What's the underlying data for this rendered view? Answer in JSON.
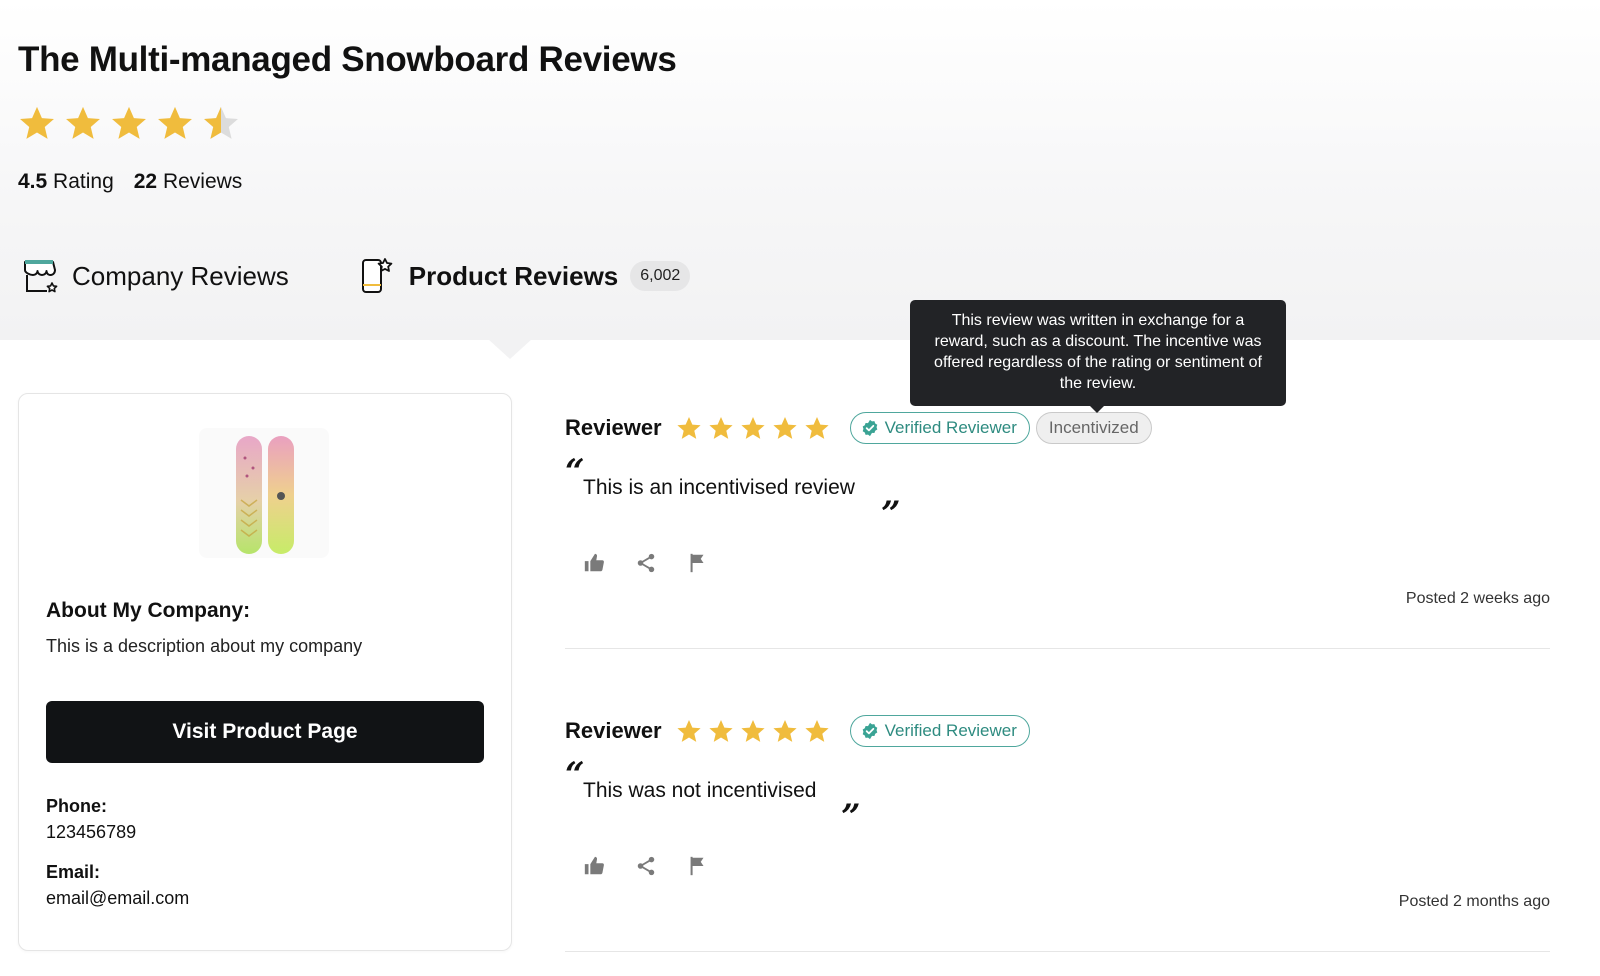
{
  "page": {
    "title": "The Multi-managed Snowboard Reviews",
    "rating_value": "4.5",
    "rating_label": "Rating",
    "reviews_value": "22",
    "reviews_label": "Reviews",
    "rating_stars": 4.5
  },
  "tabs": [
    {
      "label": "Company Reviews",
      "icon": "store-star-icon",
      "active": false
    },
    {
      "label": "Product Reviews",
      "icon": "phone-star-icon",
      "active": true,
      "count": "6,002"
    }
  ],
  "sidebar": {
    "product_image": "snowboard-product-image",
    "about_title": "About My Company:",
    "about_text": "This is a description about my company",
    "visit_button": "Visit Product Page",
    "phone_label": "Phone:",
    "phone_value": "123456789",
    "email_label": "Email:",
    "email_value": "email@email.com"
  },
  "tooltip": {
    "text": "This review was written in exchange for a reward, such as a discount. The incentive was offered regardless of the rating or sentiment of the review."
  },
  "reviews": [
    {
      "reviewer": "Reviewer",
      "stars": 5,
      "verified_label": "Verified Reviewer",
      "incentivized_label": "Incentivized",
      "text": "This is an incentivised review",
      "posted": "Posted 2 weeks ago"
    },
    {
      "reviewer": "Reviewer",
      "stars": 5,
      "verified_label": "Verified Reviewer",
      "text": "This was not incentivised",
      "posted": "Posted 2 months ago"
    }
  ],
  "colors": {
    "star": "#f0bc3d",
    "star_empty": "#dcdcdc",
    "verified": "#2e8b80",
    "button_bg": "#111315",
    "tooltip_bg": "#222326"
  }
}
